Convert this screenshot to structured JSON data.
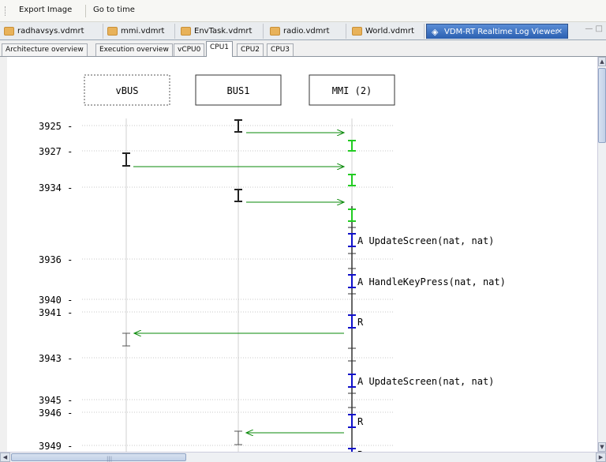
{
  "toolbar": {
    "export_image": "Export Image",
    "go_to_time": "Go to time"
  },
  "editor_tabs": [
    {
      "label": "radhavsys.vdmrt",
      "icon": "vdm-file-icon"
    },
    {
      "label": "mmi.vdmrt",
      "icon": "vdm-file-icon"
    },
    {
      "label": "EnvTask.vdmrt",
      "icon": "vdm-file-icon"
    },
    {
      "label": "radio.vdmrt",
      "icon": "vdm-file-icon"
    },
    {
      "label": "World.vdmrt",
      "icon": "vdm-file-icon"
    },
    {
      "label": "VDM-RT Realtime Log Viewer",
      "icon": "log-viewer-icon",
      "active": true
    }
  ],
  "view_tabs": [
    {
      "label": "Architecture overview"
    },
    {
      "label": "Execution overview"
    },
    {
      "label": "vCPU0"
    },
    {
      "label": "CPU1",
      "active": true
    },
    {
      "label": "CPU2"
    },
    {
      "label": "CPU3"
    }
  ],
  "diagram": {
    "lanes": [
      "vBUS",
      "BUS1",
      "MMI (2)"
    ],
    "time_labels": [
      "3925 -",
      "3927 -",
      "3934 -",
      "3936 -",
      "3940 -",
      "3941 -",
      "3943 -",
      "3945 -",
      "3946 -",
      "3949 -"
    ],
    "events": [
      "A UpdateScreen(nat, nat)",
      "A HandleKeyPress(nat, nat)",
      "R",
      "A UpdateScreen(nat, nat)",
      "R",
      "R"
    ]
  },
  "colors": {
    "message_arrow": "#0a8a0a",
    "op_bar": "#1010c8",
    "active_bar": "#22cc22",
    "tab_active": "#2a5fb0"
  }
}
